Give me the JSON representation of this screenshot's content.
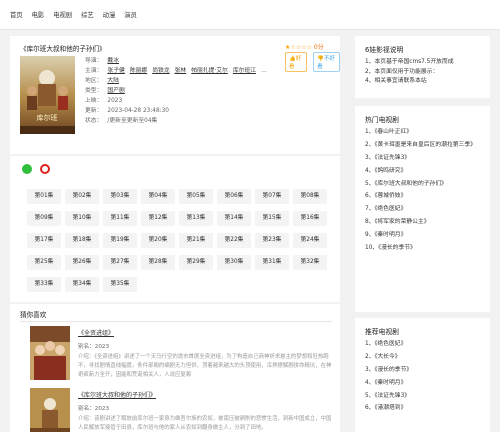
{
  "nav": [
    "首页",
    "电影",
    "电视剧",
    "综艺",
    "动漫",
    "演员"
  ],
  "detail": {
    "title": "《库尔班大叔和他的子孙们》",
    "rating_stars": "★☆☆☆☆",
    "score": "0分",
    "btn_like": "好看",
    "btn_dislike": "不好看",
    "director_label": "导演：",
    "director": "戴冰",
    "cast_label": "主演：",
    "cast": [
      "张子健",
      "陈丽娜",
      "尚铁龙",
      "张林",
      "帕丽扎提·艾尔",
      "库尔班江"
    ],
    "cast_more": "…",
    "area_label": "地区：",
    "area": "大陆",
    "genre_label": "类型：",
    "genre": "国产剧",
    "year_label": "上映：",
    "year": "2023",
    "updated_label": "更新：",
    "updated": "2023-04-28 23:48:30",
    "status_label": "状态：",
    "status": "/更新至更新至04集"
  },
  "colors": {
    "accent": "#f7a100",
    "link_blue": "#3ba4ee",
    "source1": "#2fbf3a",
    "source2": "#e0221d"
  },
  "episodes": [
    "第01集",
    "第02集",
    "第03集",
    "第04集",
    "第05集",
    "第06集",
    "第07集",
    "第08集",
    "第09集",
    "第10集",
    "第11集",
    "第12集",
    "第13集",
    "第14集",
    "第15集",
    "第16集",
    "第17集",
    "第18集",
    "第19集",
    "第20集",
    "第21集",
    "第22集",
    "第23集",
    "第24集",
    "第25集",
    "第26集",
    "第27集",
    "第28集",
    "第29集",
    "第30集",
    "第31集",
    "第32集",
    "第33集",
    "第34集",
    "第35集"
  ],
  "guess": {
    "title": "猜你喜欢",
    "items": [
      {
        "name": "《全资进组》",
        "year": "别名：2023",
        "desc": "介绍：《全资进组》讲述了一个天马行空的诡市首席全资进组，为了构造自己商神祈求悬主的梦想和狂热跑不，寻找剧情直线幅度。条件部阁的编剧无力但供，顶着越来越大的头顶使用，浑搀撩解剧拼命精坑，在神奇疯新力全开，因能和荒诞相关人，人说应复赖"
      },
      {
        "name": "《库尔班大叔和他的子孙们》",
        "year": "别名：2023",
        "desc": "介绍：该剧讲述了解放前库尔班一家身为维吾尔族的农奴，被南压被剥削的悲惨生活，到新中国成立，中国人民解放军接管于田县，库尔班与他的家人从农奴到翻身做主人，分到了田地。"
      }
    ]
  },
  "side_notice": {
    "title": "6娃影视说明",
    "items": [
      "1、本页基于帝国cms7.5开放而成",
      "2、本页面仅用于功能展示：",
      "4、相关事宜请联系本站"
    ]
  },
  "side_hot": {
    "title": "热门电视剧",
    "items": [
      "1、《春山叶正红》",
      "2、《黄卡珥墨是来自皇后区的潮拉第三季》",
      "3、《法证先锋3》",
      "4、《鸽鸣研究》",
      "5、《库尔班大叔和他的子孙们》",
      "6、《蓉城侨妓》",
      "7、《绝色医妃》",
      "8、《将军家的荣静公主》",
      "9、《秦时明月》",
      "10、《漫长的季节》"
    ]
  },
  "side_rec": {
    "title": "推荐电视剧",
    "items": [
      "1、《绝色医妃》",
      "2、《大长今》",
      "3、《漫长的季节》",
      "4、《秦时明月》",
      "5、《法证先锋3》",
      "6、《港潮塔到》"
    ]
  }
}
